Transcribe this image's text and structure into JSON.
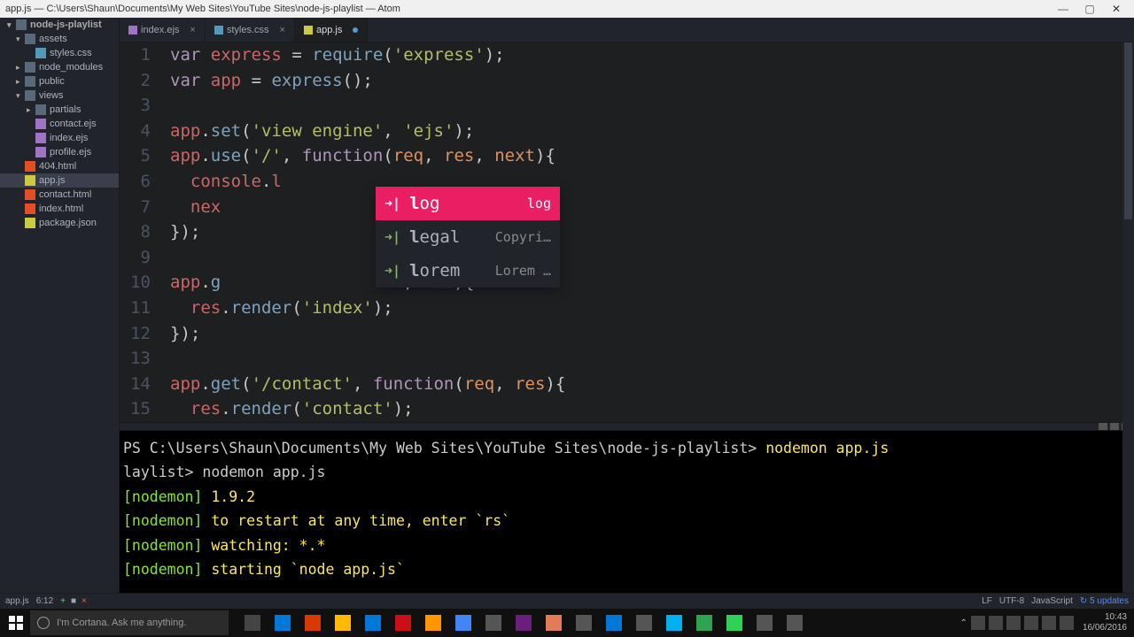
{
  "window": {
    "title": "app.js — C:\\Users\\Shaun\\Documents\\My Web Sites\\YouTube Sites\\node-js-playlist — Atom"
  },
  "project": {
    "root": "node-js-playlist",
    "tree": [
      {
        "name": "assets",
        "type": "folder",
        "expanded": true,
        "lvl": 1,
        "children": [
          {
            "name": "styles.css",
            "type": "css",
            "lvl": 2
          }
        ]
      },
      {
        "name": "node_modules",
        "type": "folder",
        "expanded": false,
        "lvl": 1
      },
      {
        "name": "public",
        "type": "folder",
        "expanded": false,
        "lvl": 1
      },
      {
        "name": "views",
        "type": "folder",
        "expanded": true,
        "lvl": 1,
        "children": [
          {
            "name": "partials",
            "type": "folder",
            "expanded": false,
            "lvl": 2
          },
          {
            "name": "contact.ejs",
            "type": "ejs",
            "lvl": 2
          },
          {
            "name": "index.ejs",
            "type": "ejs",
            "lvl": 2
          },
          {
            "name": "profile.ejs",
            "type": "ejs",
            "lvl": 2
          }
        ]
      },
      {
        "name": "404.html",
        "type": "html",
        "lvl": 1
      },
      {
        "name": "app.js",
        "type": "js",
        "lvl": 1,
        "selected": true
      },
      {
        "name": "contact.html",
        "type": "html",
        "lvl": 1
      },
      {
        "name": "index.html",
        "type": "html",
        "lvl": 1
      },
      {
        "name": "package.json",
        "type": "json",
        "lvl": 1
      }
    ]
  },
  "tabs": [
    {
      "label": "index.ejs",
      "type": "ejs",
      "modified": false
    },
    {
      "label": "styles.css",
      "type": "css",
      "modified": false
    },
    {
      "label": "app.js",
      "type": "js",
      "modified": true,
      "active": true
    }
  ],
  "autocomplete": {
    "selected": 0,
    "items": [
      {
        "label": "log",
        "hint": "log",
        "match": "l"
      },
      {
        "label": "legal",
        "hint": "Copyri…",
        "match": "l"
      },
      {
        "label": "lorem",
        "hint": "Lorem …",
        "match": "l"
      }
    ]
  },
  "terminal": {
    "prompt": "PS C:\\Users\\Shaun\\Documents\\My Web Sites\\YouTube Sites\\node-js-playlist>",
    "cmd": "nodemon app.js",
    "line2": "laylist> nodemon app.js",
    "out": [
      "[nodemon] 1.9.2",
      "[nodemon] to restart at any time, enter `rs`",
      "[nodemon] watching: *.*",
      "[nodemon] starting `node app.js`"
    ]
  },
  "status": {
    "file": "app.js",
    "pos": "6:12",
    "git_plus": "+",
    "git_square": "■",
    "git_minus": "×",
    "encoding_lf": "LF",
    "encoding": "UTF-8",
    "lang": "JavaScript",
    "updates": "5 updates"
  },
  "taskbar": {
    "search_placeholder": "I'm Cortana. Ask me anything.",
    "clock_time": "10:43",
    "clock_date": "16/06/2016"
  },
  "code_lines": 15
}
